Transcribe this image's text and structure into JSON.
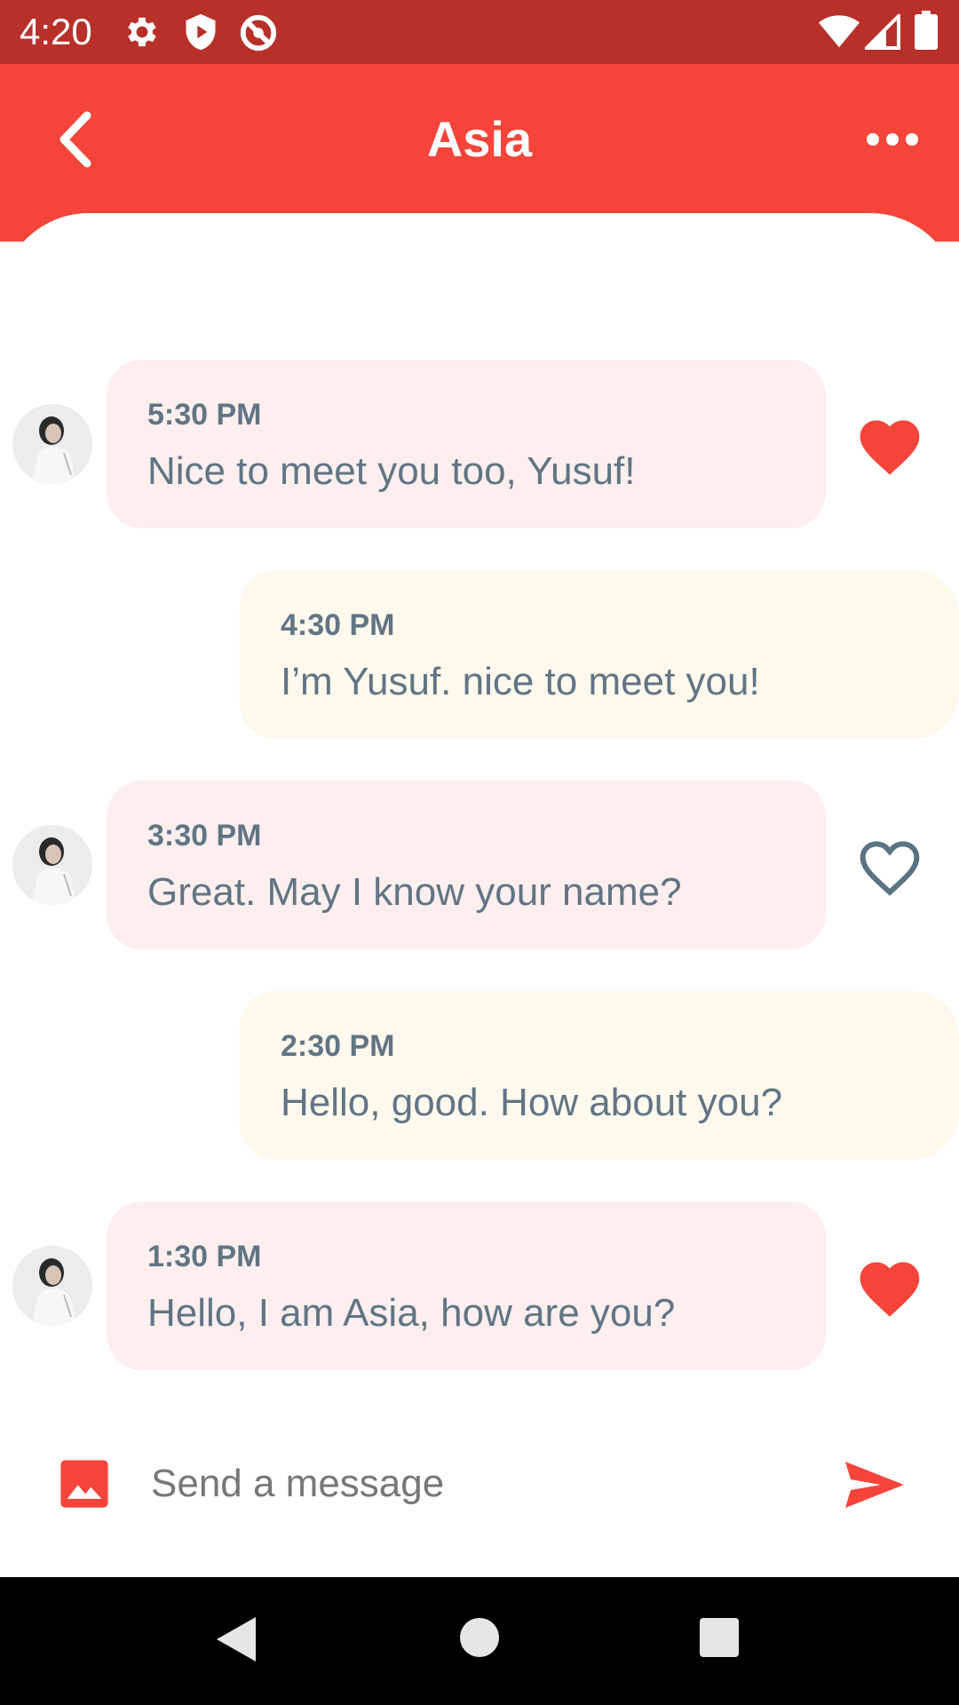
{
  "status_bar": {
    "time": "4:20",
    "icons": [
      "gear-icon",
      "shield-play-icon",
      "no-sync-icon",
      "wifi-icon",
      "signal-icon",
      "battery-icon"
    ]
  },
  "header": {
    "title": "Asia",
    "back_icon": "chevron-left-icon",
    "more_icon": "more-horizontal-icon"
  },
  "colors": {
    "accent": "#f5443a",
    "status_bar": "#b8302a",
    "incoming_bubble": "#feeeee",
    "outgoing_bubble": "#fff8ec",
    "message_text": "#607585"
  },
  "messages": [
    {
      "direction": "incoming",
      "time": "5:30 PM",
      "text": "Nice to meet you too, Yusuf!",
      "liked": true
    },
    {
      "direction": "outgoing",
      "time": "4:30 PM",
      "text": "I’m Yusuf. nice to meet you!"
    },
    {
      "direction": "incoming",
      "time": "3:30 PM",
      "text": "Great. May I know your name?",
      "liked": false
    },
    {
      "direction": "outgoing",
      "time": "2:30 PM",
      "text": "Hello, good. How about you?"
    },
    {
      "direction": "incoming",
      "time": "1:30 PM",
      "text": "Hello, I am Asia, how are you?",
      "liked": true
    }
  ],
  "composer": {
    "placeholder": "Send a message",
    "value": "",
    "image_icon": "image-icon",
    "send_icon": "send-icon"
  },
  "nav_bar": {
    "icons": [
      "back-triangle-icon",
      "home-circle-icon",
      "recents-square-icon"
    ]
  }
}
